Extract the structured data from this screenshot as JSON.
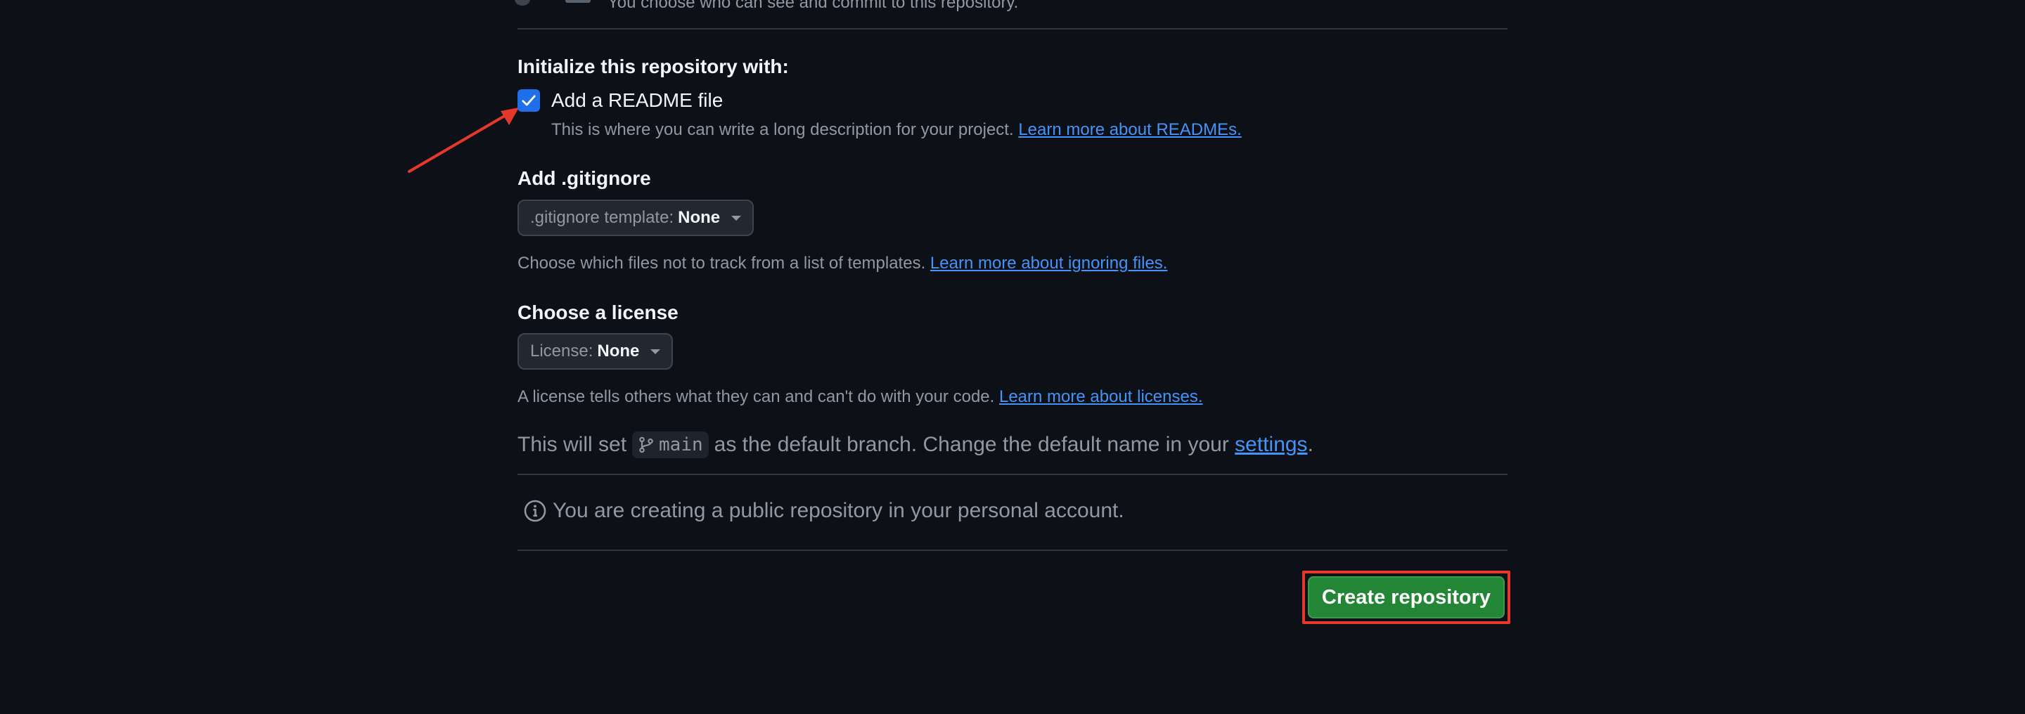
{
  "visibility": {
    "private_description": "You choose who can see and commit to this repository."
  },
  "initialize": {
    "heading": "Initialize this repository with:",
    "readme": {
      "label": "Add a README file",
      "checked": true,
      "description": "This is where you can write a long description for your project.",
      "link": "Learn more about READMEs."
    }
  },
  "gitignore": {
    "heading": "Add .gitignore",
    "select_prefix": ".gitignore template:",
    "select_value": "None",
    "description": "Choose which files not to track from a list of templates.",
    "link": "Learn more about ignoring files."
  },
  "license": {
    "heading": "Choose a license",
    "select_prefix": "License:",
    "select_value": "None",
    "description": "A license tells others what they can and can't do with your code.",
    "link": "Learn more about licenses."
  },
  "branch": {
    "prefix": "This will set",
    "name": "main",
    "middle": "as the default branch. Change the default name in your",
    "link": "settings",
    "suffix": "."
  },
  "info": {
    "icon": "info-icon",
    "text": "You are creating a public repository in your personal account."
  },
  "actions": {
    "create_label": "Create repository"
  },
  "colors": {
    "background": "#0d1117",
    "accent_link": "#4493f8",
    "primary_button": "#238636",
    "checkbox": "#1f6feb",
    "annotation": "#e5382b"
  }
}
